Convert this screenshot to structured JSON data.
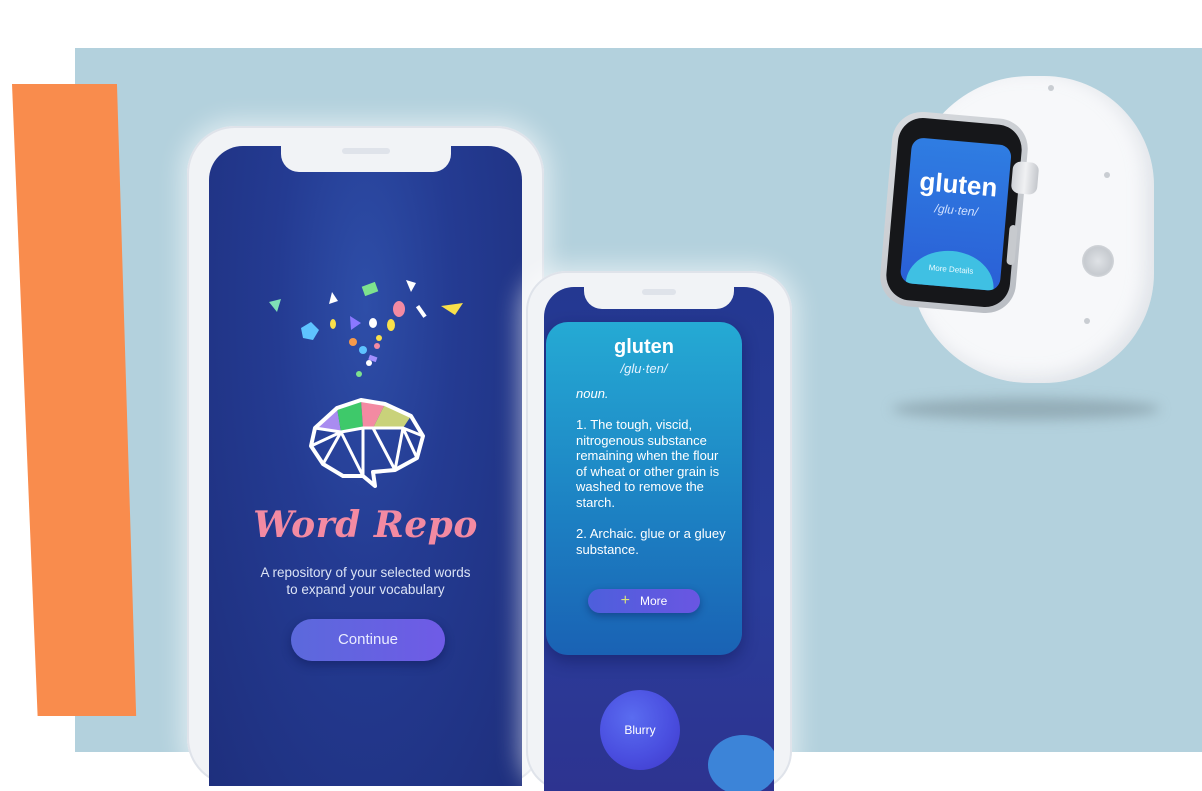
{
  "colors": {
    "background_panel": "#b3d1dd",
    "accent_strip": "#f98c4d",
    "app_title": "#f38aa2",
    "primary_button": "#6366e0",
    "definition_card": "#1f8ecb"
  },
  "intro_screen": {
    "app_name": "Word Repo",
    "subtitle_line1": "A repository of your selected words",
    "subtitle_line2": "to expand your vocabulary",
    "continue_label": "Continue",
    "icons": [
      "confetti-icon",
      "brain-icon"
    ]
  },
  "definition_screen": {
    "word": "gluten",
    "phonetic": "/glu·ten/",
    "part_of_speech": "noun.",
    "definitions": [
      "1. The tough, viscid, nitrogenous substance remaining when the flour of wheat or other grain is washed to remove the starch.",
      "2. Archaic. glue or a gluey substance."
    ],
    "more_label": "More",
    "more_icon": "plus-icon",
    "blurry_label": "Blurry"
  },
  "watch_screen": {
    "word": "gluten",
    "phonetic": "/glu·ten/",
    "more_details_label": "More Details"
  }
}
